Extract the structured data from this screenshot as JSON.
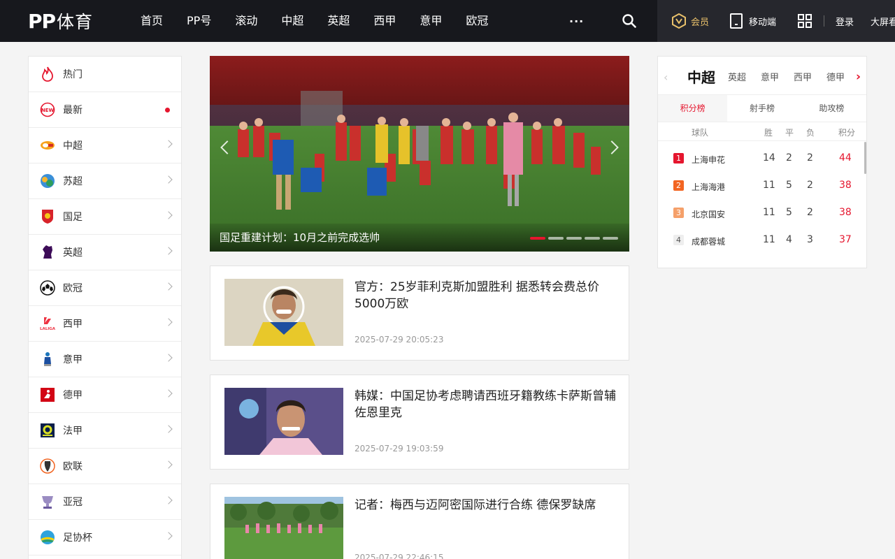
{
  "header": {
    "logo_pp": "PP",
    "logo_text": "体育",
    "nav": [
      "首页",
      "PP号",
      "滚动",
      "中超",
      "英超",
      "西甲",
      "意甲",
      "欧冠"
    ],
    "more": "···",
    "vip": "会员",
    "mobile": "移动端",
    "login": "登录",
    "bigscreen": "大屏看"
  },
  "sidebar": {
    "items": [
      {
        "label": "热门",
        "icon": "flame-icon"
      },
      {
        "label": "最新",
        "icon": "new-badge-icon"
      },
      {
        "label": "中超",
        "icon": "csl-logo-icon"
      },
      {
        "label": "苏超",
        "icon": "jiangsu-league-icon"
      },
      {
        "label": "国足",
        "icon": "china-team-icon"
      },
      {
        "label": "英超",
        "icon": "premier-league-icon"
      },
      {
        "label": "欧冠",
        "icon": "champions-league-icon"
      },
      {
        "label": "西甲",
        "icon": "laliga-icon"
      },
      {
        "label": "意甲",
        "icon": "serie-a-icon"
      },
      {
        "label": "德甲",
        "icon": "bundesliga-icon"
      },
      {
        "label": "法甲",
        "icon": "ligue1-icon"
      },
      {
        "label": "欧联",
        "icon": "europa-league-icon"
      },
      {
        "label": "亚冠",
        "icon": "afc-cup-icon"
      },
      {
        "label": "足协杯",
        "icon": "fa-cup-icon"
      }
    ]
  },
  "banner": {
    "caption": "国足重建计划：10月之前完成选帅",
    "slide_count": 5,
    "active_slide": 1
  },
  "news": [
    {
      "title": "官方：25岁菲利克斯加盟胜利 据悉转会费总价5000万欧",
      "time": "2025-07-29 20:05:23"
    },
    {
      "title": "韩媒：中国足协考虑聘请西班牙籍教练卡萨斯曾辅佐恩里克",
      "time": "2025-07-29 19:03:59"
    },
    {
      "title": "记者：梅西与迈阿密国际进行合练 德保罗缺席",
      "time": "2025-07-29 22:46:15"
    }
  ],
  "standings": {
    "leagues": [
      "中超",
      "英超",
      "意甲",
      "西甲",
      "德甲"
    ],
    "active_league": "中超",
    "tabs": [
      "积分榜",
      "射手榜",
      "助攻榜"
    ],
    "active_tab": "积分榜",
    "columns": {
      "team": "球队",
      "w": "胜",
      "d": "平",
      "l": "负",
      "pts": "积分"
    },
    "rows": [
      {
        "rank": "1",
        "team": "上海申花",
        "w": "14",
        "d": "2",
        "l": "2",
        "pts": "44",
        "color": "#e5162e"
      },
      {
        "rank": "2",
        "team": "上海海港",
        "w": "11",
        "d": "5",
        "l": "2",
        "pts": "38",
        "color": "#f26522"
      },
      {
        "rank": "3",
        "team": "北京国安",
        "w": "11",
        "d": "5",
        "l": "2",
        "pts": "38",
        "color": "#f5a06a"
      },
      {
        "rank": "4",
        "team": "成都蓉城",
        "w": "11",
        "d": "4",
        "l": "3",
        "pts": "37",
        "color": "#eeeeee"
      }
    ]
  }
}
